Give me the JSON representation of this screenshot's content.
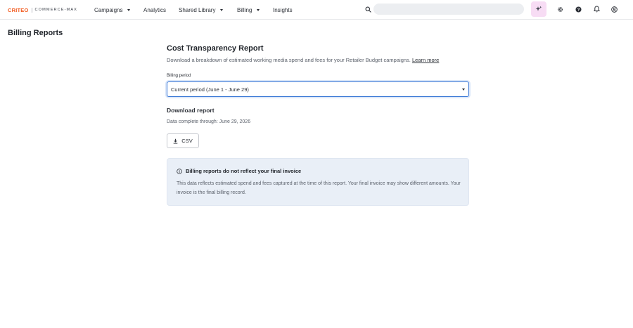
{
  "brand": {
    "criteo": "CRITEO",
    "product": "COMMERCE-MAX",
    "accent": "#f25c21"
  },
  "nav": {
    "items": [
      {
        "label": "Campaigns",
        "dropdown": true
      },
      {
        "label": "Analytics",
        "dropdown": false
      },
      {
        "label": "Shared Library",
        "dropdown": true
      },
      {
        "label": "Billing",
        "dropdown": true
      },
      {
        "label": "Insights",
        "dropdown": false
      }
    ],
    "search": {
      "placeholder": "",
      "icon": "search-icon"
    },
    "actions": [
      "sparkle-icon",
      "gear-icon",
      "help-icon",
      "bell-icon",
      "user-icon"
    ]
  },
  "page": {
    "title": "Billing Reports"
  },
  "report": {
    "title": "Cost Transparency Report",
    "description": "Download a breakdown of estimated working media spend and fees for your Retailer Budget campaigns.",
    "learn_more": "Learn more",
    "billing_period_label": "Billing period",
    "billing_period_value": "Current period (June 1 - June 29)",
    "download_heading": "Download report",
    "data_complete": "Data complete through: June 29, 2026",
    "csv_label": "CSV"
  },
  "notice": {
    "title": "Billing reports do not reflect your final invoice",
    "body": "This data reflects estimated spend and fees captured at the time of this report. Your final invoice may show different amounts. Your invoice is the final billing record."
  }
}
